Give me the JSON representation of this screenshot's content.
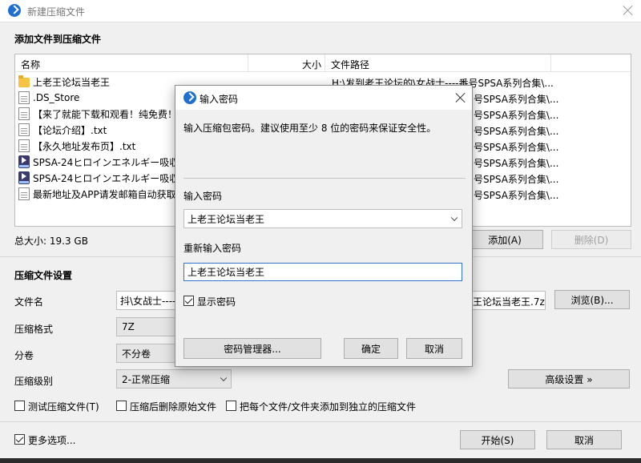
{
  "window": {
    "title": "新建压缩文件"
  },
  "add_section": {
    "title": "添加文件到压缩文件",
    "columns": {
      "name": "名称",
      "size": "大小",
      "path": "文件路径"
    },
    "rows": [
      {
        "name": "上老王论坛当老王",
        "icon": "folder-icon",
        "path": "H:\\发到老王论坛的\\女战士----番号SPSA系列合集\\..."
      },
      {
        "name": ".DS_Store",
        "icon": "document-icon",
        "path": "号SPSA系列合集\\..."
      },
      {
        "name": "【来了就能下载和观看！纯免费！",
        "icon": "document-icon",
        "path": "号SPSA系列合集\\..."
      },
      {
        "name": "【论坛介绍】.txt",
        "icon": "document-icon",
        "path": "号SPSA系列合集\\..."
      },
      {
        "name": "【永久地址发布页】.txt",
        "icon": "document-icon",
        "path": "号SPSA系列合集\\..."
      },
      {
        "name": "SPSA-24ヒロインエネルギー吸収",
        "icon": "mp4-icon",
        "path": "号SPSA系列合集\\..."
      },
      {
        "name": "SPSA-24ヒロインエネルギー吸収",
        "icon": "mp4-icon",
        "path": "号SPSA系列合集\\..."
      },
      {
        "name": "最新地址及APP请发邮箱自动获取!",
        "icon": "document-icon",
        "path": "号SPSA系列合集\\..."
      }
    ],
    "total_size": "总大小: 19.3 GB",
    "add_button": "添加(A)",
    "delete_button": "删除(D)"
  },
  "settings": {
    "title": "压缩文件设置",
    "filename_label": "文件名",
    "filename_value": "抖\\女战士----",
    "filename_right_value": "王论坛当老王.7z",
    "browse_button": "浏览(B)...",
    "format_label": "压缩格式",
    "format_value": "7Z",
    "split_label": "分卷",
    "split_value": "不分卷",
    "level_label": "压缩级别",
    "level_value": "2-正常压缩",
    "advanced_button": "高级设置 »"
  },
  "options": {
    "test_archive": "测试压缩文件(T)",
    "delete_after": "压缩后删除原始文件",
    "separate_archives": "把每个文件/文件夹添加到独立的压缩文件",
    "more_options": "更多选项...",
    "start_button": "开始(S)",
    "cancel_button": "取消"
  },
  "dialog": {
    "title": "输入密码",
    "hint": "输入压缩包密码。建议使用至少 8 位的密码来保证安全性。",
    "password_label": "输入密码",
    "password_value": "上老王论坛当老王",
    "reenter_label": "重新输入密码",
    "reenter_value": "上老王论坛当老王",
    "show_password": "显示密码",
    "manager_button": "密码管理器...",
    "ok_button": "确定",
    "cancel_button": "取消"
  }
}
